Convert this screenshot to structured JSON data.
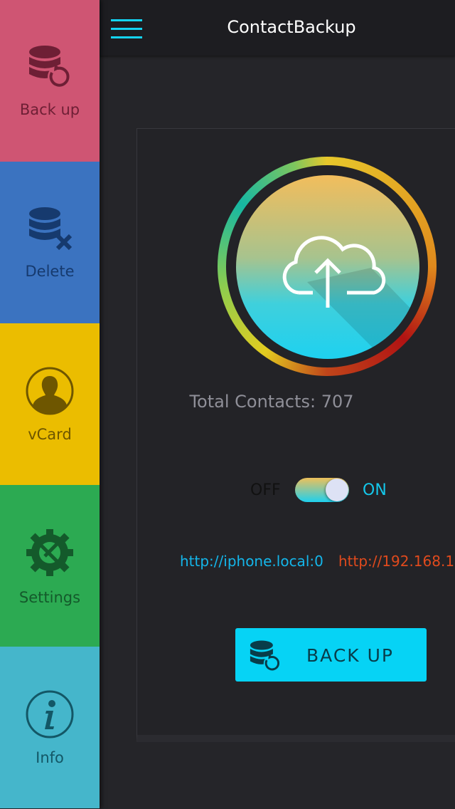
{
  "app": {
    "title": "ContactBackup"
  },
  "sidebar": {
    "items": [
      {
        "label": "Back up",
        "icon": "database-backup-icon",
        "bg": "#cf5573",
        "fg": "#6e1f35"
      },
      {
        "label": "Delete",
        "icon": "database-delete-icon",
        "bg": "#3b73c0",
        "fg": "#163a6e"
      },
      {
        "label": "vCard",
        "icon": "user-icon",
        "bg": "#ebbd00",
        "fg": "#6e5600"
      },
      {
        "label": "Settings",
        "icon": "settings-icon",
        "bg": "#2caa52",
        "fg": "#145a2b"
      },
      {
        "label": "Info",
        "icon": "info-icon",
        "bg": "#45b6cb",
        "fg": "#135766"
      }
    ]
  },
  "main": {
    "total_contacts": "Total Contacts: 707",
    "toggle": {
      "off_label": "OFF",
      "on_label": "ON",
      "state": "on"
    },
    "url_local": "http://iphone.local:0",
    "url_ip": "http://192.168.1.",
    "backup_button": "BACK UP"
  }
}
